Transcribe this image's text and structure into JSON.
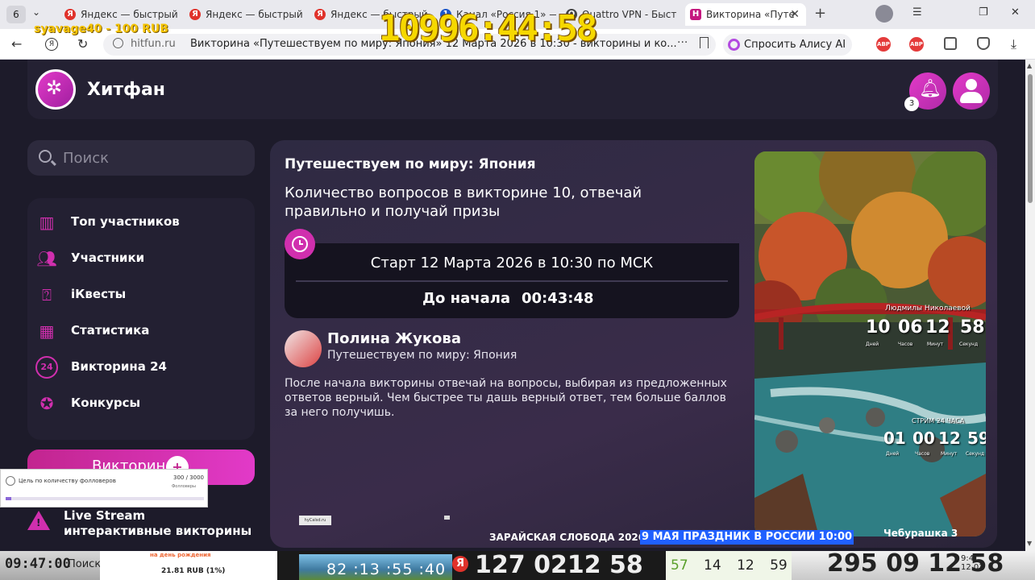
{
  "browser": {
    "tab_count": "6",
    "tabs": [
      {
        "title": "Яндекс — быстрый",
        "favicon": "Я"
      },
      {
        "title": "Яндекс — быстрый",
        "favicon": "Я"
      },
      {
        "title": "Яндекс — быстрый",
        "favicon": "Я"
      },
      {
        "title": "Канал «Россия 1» —",
        "favicon": "1"
      },
      {
        "title": "Quattro VPN - Быст",
        "favicon": "Q"
      },
      {
        "title": "Викторина «Путе",
        "favicon": "H",
        "active": true
      }
    ],
    "url_host": "hitfun.ru",
    "page_title": "Викторина «Путешествуем по миру: Япония» 12 Марта 2026 в 10:30 - викторины и ко...",
    "alice_label": "Спросить Алису AI",
    "ext_labels": [
      "ABP",
      "ABP"
    ]
  },
  "overlay": {
    "stream_name": "syavage40 - 100 RUB",
    "big_timer": "10996:44:58"
  },
  "site": {
    "brand": "Хитфан",
    "notifications_count": "3",
    "search_placeholder": "Поиск",
    "nav": [
      {
        "label": "Топ участников",
        "icon": "chart-icon"
      },
      {
        "label": "Участники",
        "icon": "users-icon"
      },
      {
        "label": "iКвесты",
        "icon": "quest-icon"
      },
      {
        "label": "Статистика",
        "icon": "stats-icon"
      },
      {
        "label": "Викторина 24",
        "icon": "24-icon",
        "icon_text": "24"
      },
      {
        "label": "Конкурсы",
        "icon": "medal-icon"
      }
    ],
    "quiz_button": "Викторина",
    "live_title": "Live Stream",
    "live_subtitle": "интерактивные викторины"
  },
  "quiz": {
    "title": "Путешествуем по миру: Япония",
    "description": "Количество вопросов в викторине 10, отвечай правильно и получай призы",
    "start_text": "Старт 12 Марта 2026 в 10:30 по МСК",
    "countdown_label": "До начала",
    "countdown_value": "00:43:48",
    "author_name": "Полина Жукова",
    "author_subtitle": "Путешествуем по миру: Япония",
    "rules": "После начала викторины отвечай на вопросы, выбирая из предложенных ответов верный. Чем быстрее ты дашь верный ответ, тем больше баллов за него получишь."
  },
  "image_overlay": {
    "caption1": "Людмилы Николаевой",
    "timer1": [
      "10",
      "06",
      "12",
      "58"
    ],
    "timer1_units": [
      "Дней",
      "Часов",
      "Минут",
      "Секунд"
    ],
    "caption2": "СТРИМ 24 ЧАСА",
    "timer2": [
      "01",
      "00",
      "12",
      "59"
    ],
    "timer2_units": [
      "Дней",
      "Часов",
      "Минут",
      "Секунд"
    ]
  },
  "goal_widget": {
    "label": "Цель по количеству фолловеров",
    "value": "300 / 3000",
    "sub": "Фолловеры",
    "progress": 0.03
  },
  "mini_widget": "hyCalsd.ru",
  "tickers": {
    "left": "ЗАРАЙСКАЯ СЛОБОДА 2026",
    "middle": "9 МАЯ ПРАЗДНИК В РОССИИ 10:00",
    "right": "Чебурашка 3"
  },
  "bottom_strip": {
    "time": "09:47:00",
    "search": "Поиск",
    "bday_title": "на день рождения",
    "bday_rub": "21.81 RUB (1%)",
    "photo_time": "82 :13 :55 :40",
    "big_time": "127 0212 58",
    "green_first": "57",
    "green_rest": "14 12 59",
    "right_time": "295 09 12 58",
    "clock_time": "9:4",
    "clock_date": "12.03"
  }
}
